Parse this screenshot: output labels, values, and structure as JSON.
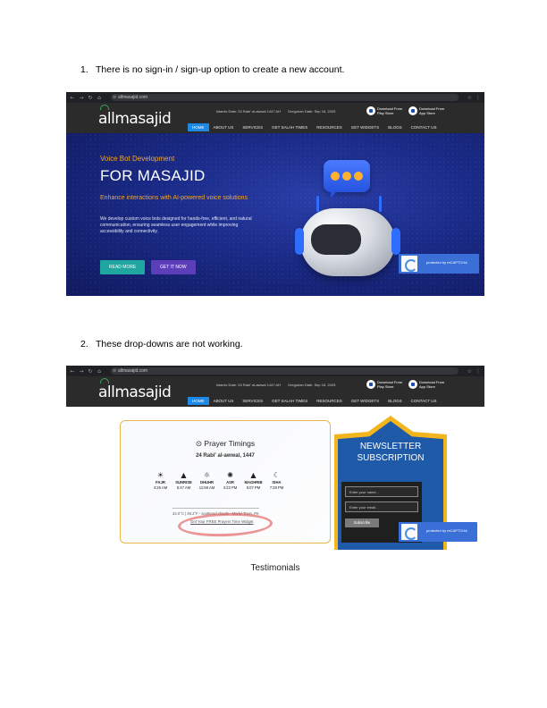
{
  "items": [
    {
      "num": "1.",
      "text": "There is no sign-in / sign-up option to create a new account."
    },
    {
      "num": "2.",
      "text": "These drop-downs are not working."
    }
  ],
  "browser": {
    "url": "allmasajid.com",
    "nav_icons": [
      "back-icon",
      "forward-icon",
      "reload-icon",
      "home-icon"
    ]
  },
  "site": {
    "logo": "allmasajid",
    "islamic_date": "Islamic Date: 24 Rabi' al-awwal 1447 AH",
    "gregorian_date": "Gregorian Date: Sep 16, 2025",
    "play_store": "Download From Play Store",
    "app_store": "Download From App Store",
    "menu": [
      "HOME",
      "ABOUT US",
      "SERVICES",
      "GET SALAH TIMES",
      "RESOURCES",
      "GET WIDGETS",
      "BLOGS",
      "CONTACT US"
    ]
  },
  "hero": {
    "kicker": "Voice Bot Development",
    "headline": "FOR MASAJID",
    "sub": "Enhance interactions with AI-powered voice solutions",
    "para": "We develop custom voice bots designed for hands-free, efficient, and natural communication, ensuring seamless user engagement while improving accessibility and connectivity.",
    "read_more": "READ MORE",
    "get_it_now": "GET IT NOW"
  },
  "recaptcha": {
    "text": "protected by reCAPTCHA"
  },
  "prayer": {
    "title": "Prayer Timings",
    "date": "24 Rabi' al-awwal, 1447",
    "slots": [
      {
        "name": "FAJR",
        "time": "4:26 AM",
        "icon": "sunrise-icon"
      },
      {
        "name": "SUNRISE",
        "time": "5:47 AM",
        "icon": "mountain-sun-icon"
      },
      {
        "name": "DHUHR",
        "time": "11:58 AM",
        "icon": "sun-icon"
      },
      {
        "name": "ASR",
        "time": "4:23 PM",
        "icon": "sun-small-icon"
      },
      {
        "name": "MAGHRIB",
        "time": "6:07 PM",
        "icon": "mountain-icon"
      },
      {
        "name": "ISHA",
        "time": "7:29 PM",
        "icon": "moon-star-icon"
      }
    ],
    "weather": "34.0°C | 49.2°F - scattered clouds - Model Town, PK",
    "link": "Get Your FREE Prayers Time Widget"
  },
  "newsletter": {
    "title_line1": "NEWSLETTER",
    "title_line2": "SUBSCRIPTION",
    "name_placeholder": "Enter your name...",
    "email_placeholder": "Enter your email...",
    "subscribe": "Subscribe"
  },
  "testimonials": "Testimonials"
}
